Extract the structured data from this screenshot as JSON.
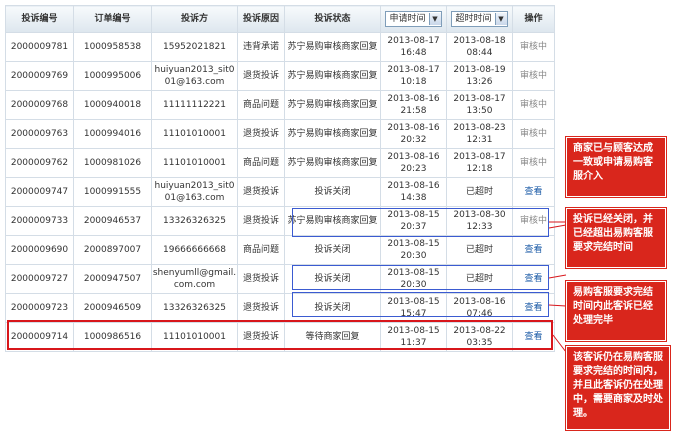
{
  "table": {
    "headers": {
      "complaint_no": "投诉编号",
      "order_no": "订单编号",
      "complainant": "投诉方",
      "reason": "投诉原因",
      "status": "投诉状态",
      "apply_time": "申请时间",
      "timeout_time": "超时时间",
      "action": "操作"
    },
    "rows": [
      {
        "id": "2000009781",
        "order": "1000958538",
        "party": "15952021821",
        "reason": "违背承诺",
        "status": "苏宁易购审核商家回复",
        "apply_date": "2013-08-17",
        "apply_clock": "16:48",
        "timeout_date": "2013-08-18",
        "timeout_clock": "08:44",
        "action": "审核中"
      },
      {
        "id": "2000009769",
        "order": "1000995006",
        "party": "huiyuan2013_sit001@163.com",
        "reason": "退货投诉",
        "status": "苏宁易购审核商家回复",
        "apply_date": "2013-08-17",
        "apply_clock": "10:18",
        "timeout_date": "2013-08-19",
        "timeout_clock": "13:26",
        "action": "审核中"
      },
      {
        "id": "2000009768",
        "order": "1000940018",
        "party": "11111112221",
        "reason": "商品问题",
        "status": "苏宁易购审核商家回复",
        "apply_date": "2013-08-16",
        "apply_clock": "21:58",
        "timeout_date": "2013-08-17",
        "timeout_clock": "13:50",
        "action": "审核中"
      },
      {
        "id": "2000009763",
        "order": "1000994016",
        "party": "11101010001",
        "reason": "退货投诉",
        "status": "苏宁易购审核商家回复",
        "apply_date": "2013-08-16",
        "apply_clock": "20:32",
        "timeout_date": "2013-08-23",
        "timeout_clock": "12:31",
        "action": "审核中"
      },
      {
        "id": "2000009762",
        "order": "1000981026",
        "party": "11101010001",
        "reason": "商品问题",
        "status": "苏宁易购审核商家回复",
        "apply_date": "2013-08-16",
        "apply_clock": "20:23",
        "timeout_date": "2013-08-17",
        "timeout_clock": "12:18",
        "action": "审核中"
      },
      {
        "id": "2000009747",
        "order": "1000991555",
        "party": "huiyuan2013_sit001@163.com",
        "reason": "退货投诉",
        "status": "投诉关闭",
        "apply_date": "2013-08-16",
        "apply_clock": "14:38",
        "timeout_date": "已超时",
        "timeout_clock": "",
        "action": "查看"
      },
      {
        "id": "2000009733",
        "order": "2000946537",
        "party": "13326326325",
        "reason": "退货投诉",
        "status": "苏宁易购审核商家回复",
        "apply_date": "2013-08-15",
        "apply_clock": "20:37",
        "timeout_date": "2013-08-30",
        "timeout_clock": "12:33",
        "action": "审核中"
      },
      {
        "id": "2000009690",
        "order": "2000897007",
        "party": "19666666668",
        "reason": "商品问题",
        "status": "投诉关闭",
        "apply_date": "2013-08-15",
        "apply_clock": "20:30",
        "timeout_date": "已超时",
        "timeout_clock": "",
        "action": "查看"
      },
      {
        "id": "2000009727",
        "order": "2000947507",
        "party": "shenyumll@gmail.com.com",
        "reason": "退货投诉",
        "status": "投诉关闭",
        "apply_date": "2013-08-15",
        "apply_clock": "20:30",
        "timeout_date": "已超时",
        "timeout_clock": "",
        "action": "查看"
      },
      {
        "id": "2000009723",
        "order": "2000946509",
        "party": "13326326325",
        "reason": "退货投诉",
        "status": "投诉关闭",
        "apply_date": "2013-08-15",
        "apply_clock": "15:47",
        "timeout_date": "2013-08-16",
        "timeout_clock": "07:46",
        "action": "查看"
      },
      {
        "id": "2000009714",
        "order": "1000986516",
        "party": "11101010001",
        "reason": "退货投诉",
        "status": "等待商家回复",
        "apply_date": "2013-08-15",
        "apply_clock": "11:37",
        "timeout_date": "2013-08-22",
        "timeout_clock": "03:35",
        "action": "查看"
      }
    ]
  },
  "annotations": {
    "callout_1": "商家已与顾客达成一致或申请易购客服介入",
    "callout_2": "投诉已经关闭，并已经超出易购客服要求完结时间",
    "callout_3": "易购客服要求完结时间内此客诉已经处理完毕",
    "callout_4": "该客诉仍在易购客服要求完结的时间内，并且此客诉仍在处理中，需要商家及时处理。"
  },
  "colors": {
    "callout_bg": "#d9261c",
    "highlight_red": "#d8161b",
    "highlight_blue": "#3b5bd1",
    "link": "#1a5aa6"
  },
  "icons": {
    "dropdown": "chevron-down-icon"
  }
}
